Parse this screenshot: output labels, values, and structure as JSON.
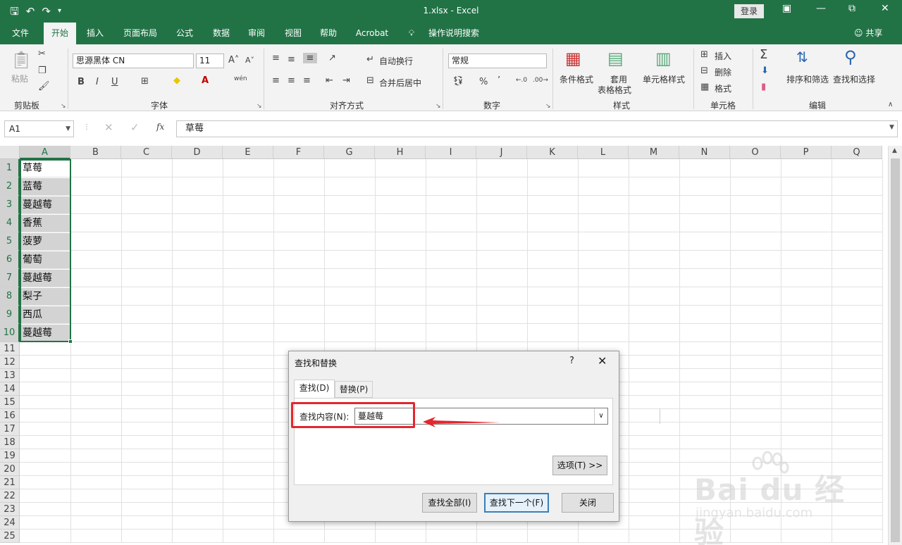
{
  "titlebar": {
    "doc_title": "1.xlsx  -  Excel",
    "login": "登录",
    "qat_icons": [
      "save-icon",
      "undo-icon",
      "redo-icon",
      "customize-qat-icon"
    ],
    "window_icons": [
      "ribbon-display-icon",
      "minimize-icon",
      "restore-icon",
      "close-icon"
    ]
  },
  "tabs": [
    "文件",
    "开始",
    "插入",
    "页面布局",
    "公式",
    "数据",
    "审阅",
    "视图",
    "帮助",
    "Acrobat",
    "操作说明搜索"
  ],
  "active_tab": "开始",
  "share": "共享",
  "ribbon": {
    "clipboard": {
      "paste": "粘贴",
      "label": "剪贴板"
    },
    "font": {
      "name": "思源黑体 CN",
      "size": "11",
      "label": "字体",
      "bold": "B",
      "italic": "I",
      "underline": "U",
      "phonetic": "wén"
    },
    "alignment": {
      "wrap": "自动换行",
      "merge": "合并后居中",
      "label": "对齐方式"
    },
    "number": {
      "format": "常规",
      "percent": "%",
      "comma": "’",
      "label": "数字"
    },
    "styles": {
      "conditional": "条件格式",
      "table_line1": "套用",
      "table_line2": "表格格式",
      "cell_styles": "单元格样式",
      "label": "样式"
    },
    "cells": {
      "insert": "插入",
      "delete": "删除",
      "format": "格式",
      "label": "单元格"
    },
    "editing": {
      "sort": "排序和筛选",
      "find": "查找和选择",
      "label": "编辑"
    }
  },
  "formula_bar": {
    "name_box": "A1",
    "fx": "fx",
    "content": "草莓"
  },
  "sheet": {
    "columns": [
      "A",
      "B",
      "C",
      "D",
      "E",
      "F",
      "G",
      "H",
      "I",
      "J",
      "K",
      "L",
      "M",
      "N",
      "O",
      "P",
      "Q"
    ],
    "rows": [
      "1",
      "2",
      "3",
      "4",
      "5",
      "6",
      "7",
      "8",
      "9",
      "10",
      "11",
      "12",
      "13",
      "14",
      "15",
      "16",
      "17",
      "18",
      "19",
      "20",
      "21",
      "22",
      "23",
      "24",
      "25"
    ],
    "cells_a": [
      "草莓",
      "蓝莓",
      "蔓越莓",
      "香蕉",
      "菠萝",
      "葡萄",
      "蔓越莓",
      "梨子",
      "西瓜",
      "蔓越莓"
    ]
  },
  "dialog": {
    "title": "查找和替换",
    "help": "?",
    "tab_find": "查找(D)",
    "tab_replace": "替换(P)",
    "find_label": "查找内容(N):",
    "find_value": "蔓越莓",
    "options": "选项(T) >>",
    "find_all": "查找全部(I)",
    "find_next": "查找下一个(F)",
    "close": "关闭"
  },
  "watermark": {
    "brand": "Bai du 经验",
    "url": "jingyan.baidu.com"
  },
  "colors": {
    "excel_green": "#217346",
    "annotation_red": "#e4262d",
    "selection_shade": "#d3d3d3"
  }
}
